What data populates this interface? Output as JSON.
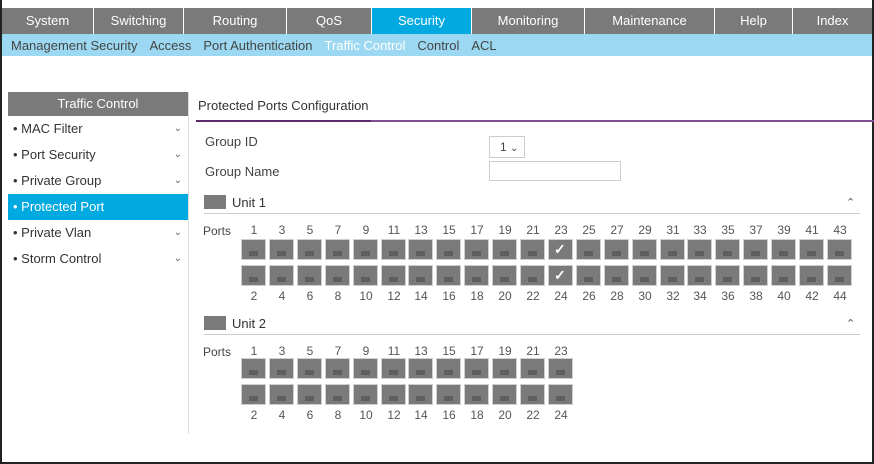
{
  "top_nav": [
    "System",
    "Switching",
    "Routing",
    "QoS",
    "Security",
    "Monitoring",
    "Maintenance",
    "Help",
    "Index"
  ],
  "top_nav_active": "Security",
  "sub_nav": [
    "Management Security",
    "Access",
    "Port Authentication",
    "Traffic Control",
    "Control",
    "ACL"
  ],
  "sub_nav_active": "Traffic Control",
  "sidebar": {
    "title": "Traffic Control",
    "items": [
      {
        "label": "MAC Filter",
        "expandable": true
      },
      {
        "label": "Port Security",
        "expandable": true
      },
      {
        "label": "Private Group",
        "expandable": true
      },
      {
        "label": "Protected Port",
        "expandable": false,
        "active": true
      },
      {
        "label": "Private Vlan",
        "expandable": true
      },
      {
        "label": "Storm Control",
        "expandable": true
      }
    ]
  },
  "main": {
    "tab": "Protected Ports Configuration",
    "group_id_label": "Group ID",
    "group_id_value": "1",
    "group_name_label": "Group Name",
    "group_name_value": "",
    "ports_label": "Ports",
    "units": [
      {
        "name": "Unit 1",
        "port_count": 44,
        "checked": [
          23,
          24
        ]
      },
      {
        "name": "Unit 2",
        "port_count": 24,
        "checked": []
      }
    ]
  },
  "colors": {
    "active_tab": "#00a9e0",
    "nav_bg": "#7a7a7a",
    "subnav_bg": "#9cd8f1",
    "accent_rule": "#7f4f8f"
  },
  "icons": {
    "chevron": "chevron-down-icon",
    "collapse": "chevron-up-icon",
    "check": "checkmark-icon"
  }
}
